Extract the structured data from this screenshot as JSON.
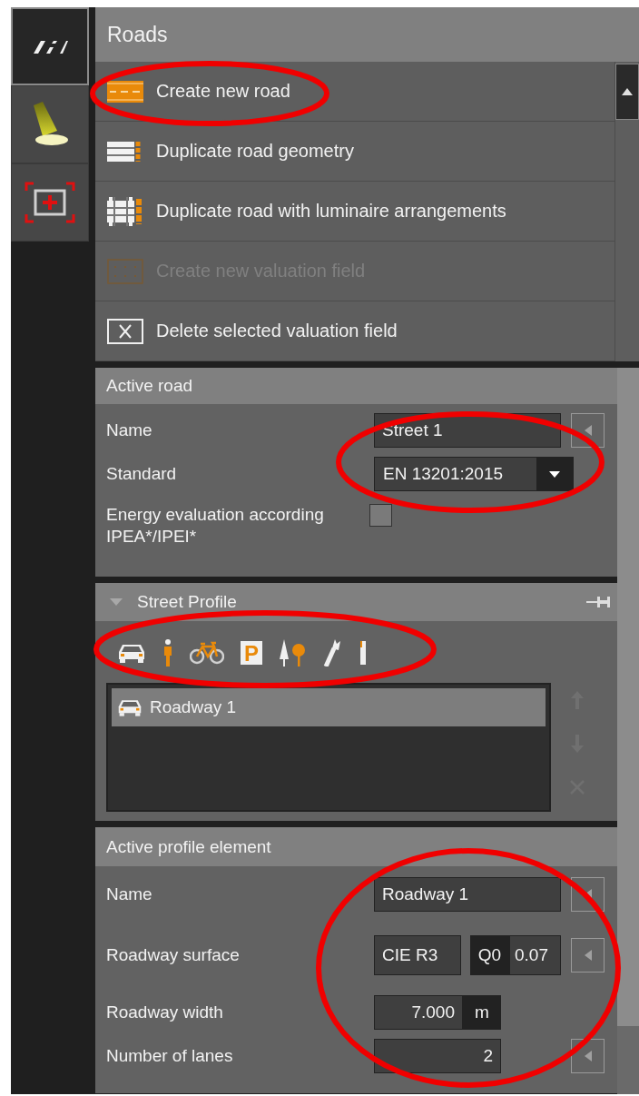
{
  "sidebar_tabs": [
    {
      "kind": "road",
      "selected": true
    },
    {
      "kind": "lamp",
      "selected": false
    },
    {
      "kind": "add-field",
      "selected": false
    }
  ],
  "roads": {
    "title": "Roads",
    "actions": [
      {
        "kind": "new-road",
        "label": "Create new road",
        "disabled": false,
        "circled": true
      },
      {
        "kind": "duplicate-geometry",
        "label": "Duplicate road geometry",
        "disabled": false,
        "circled": false
      },
      {
        "kind": "duplicate-luminaires",
        "label": "Duplicate road with luminaire arrangements",
        "disabled": false,
        "circled": false
      },
      {
        "kind": "new-field",
        "label": "Create new valuation field",
        "disabled": true,
        "circled": false
      },
      {
        "kind": "delete-field",
        "label": "Delete selected valuation field",
        "disabled": false,
        "circled": false
      }
    ]
  },
  "active_road": {
    "title": "Active road",
    "circled": true,
    "name_label": "Name",
    "name_value": "Street 1",
    "standard_label": "Standard",
    "standard_value": "EN 13201:2015",
    "energy_label": "Energy evaluation according IPEA*/IPEI*",
    "energy_checked": false
  },
  "street_profile": {
    "title": "Street Profile",
    "expanded": true,
    "tools_circled": true,
    "tools": [
      {
        "kind": "car"
      },
      {
        "kind": "pedestrian"
      },
      {
        "kind": "bicycle"
      },
      {
        "kind": "parking",
        "glyph": "P"
      },
      {
        "kind": "trees"
      },
      {
        "kind": "wrench"
      },
      {
        "kind": "pole"
      }
    ],
    "elements": [
      {
        "kind": "roadway",
        "label": "Roadway 1",
        "selected": true
      }
    ]
  },
  "active_profile_element": {
    "title": "Active profile element",
    "circled": true,
    "name_label": "Name",
    "name_value": "Roadway 1",
    "surface_label": "Roadway surface",
    "surface_value": "CIE R3",
    "q0_label": "Q0",
    "q0_value": "0.07",
    "width_label": "Roadway width",
    "width_value": "7.000",
    "width_unit": "m",
    "lanes_label": "Number of lanes",
    "lanes_value": "2"
  }
}
